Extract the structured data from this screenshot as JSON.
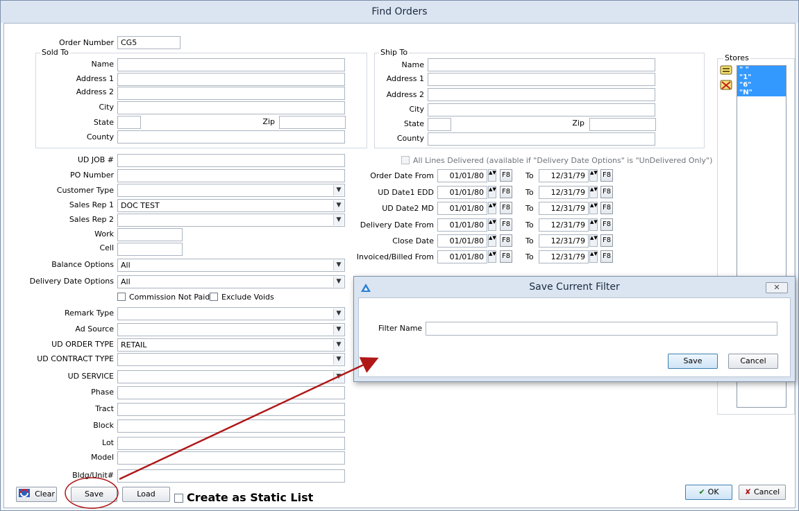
{
  "window": {
    "title": "Find Orders"
  },
  "order_number": {
    "label": "Order Number",
    "value": "CG5"
  },
  "sold_to": {
    "title": "Sold To",
    "name_label": "Name",
    "address1_label": "Address 1",
    "address2_label": "Address 2",
    "city_label": "City",
    "state_label": "State",
    "zip_label": "Zip",
    "county_label": "County"
  },
  "ship_to": {
    "title": "Ship To",
    "name_label": "Name",
    "address1_label": "Address 1",
    "address2_label": "Address 2",
    "city_label": "City",
    "state_label": "State",
    "zip_label": "Zip",
    "county_label": "County"
  },
  "fields": {
    "ud_job": "UD JOB #",
    "po_number": "PO Number",
    "customer_type": "Customer Type",
    "sales_rep1": "Sales Rep 1",
    "sales_rep1_value": "DOC TEST",
    "sales_rep2": "Sales Rep 2",
    "work": "Work",
    "cell": "Cell",
    "balance_options": "Balance Options",
    "balance_options_value": "All",
    "delivery_date_options": "Delivery Date Options",
    "delivery_date_options_value": "All",
    "commission_not_paid": "Commission Not Paid",
    "exclude_voids": "Exclude Voids",
    "remark_type": "Remark Type",
    "ad_source": "Ad Source",
    "ud_order_type": "UD ORDER TYPE",
    "ud_order_type_value": "RETAIL",
    "ud_contract_type": "UD CONTRACT TYPE",
    "ud_service": "UD SERVICE",
    "phase": "Phase",
    "tract": "Tract",
    "block": "Block",
    "lot": "Lot",
    "model": "Model",
    "bldg_unit": "Bldg/Unit#"
  },
  "all_lines_delivered": "All Lines Delivered (available if \"Delivery Date Options\" is \"UnDelivered Only\")",
  "date_ranges": [
    {
      "label": "Order Date From",
      "from": "01/01/80",
      "to_label": "To",
      "to": "12/31/79",
      "f8": "F8"
    },
    {
      "label": "UD Date1 EDD",
      "from": "01/01/80",
      "to_label": "To",
      "to": "12/31/79",
      "f8": "F8"
    },
    {
      "label": "UD Date2 MD",
      "from": "01/01/80",
      "to_label": "To",
      "to": "12/31/79",
      "f8": "F8"
    },
    {
      "label": "Delivery Date From",
      "from": "01/01/80",
      "to_label": "To",
      "to": "12/31/79",
      "f8": "F8"
    },
    {
      "label": "Close Date",
      "from": "01/01/80",
      "to_label": "To",
      "to": "12/31/79",
      "f8": "F8"
    },
    {
      "label": "Invoiced/Billed From",
      "from": "01/01/80",
      "to_label": "To",
      "to": "12/31/79",
      "f8": "F8"
    }
  ],
  "stores": {
    "title": "Stores",
    "items": [
      "\" \"",
      "\"1\"",
      "\"6\"",
      "\"N\""
    ]
  },
  "buttons": {
    "clear": "Clear",
    "save": "Save",
    "load": "Load",
    "create_static": "Create as Static List",
    "ok": "OK",
    "cancel": "Cancel"
  },
  "dialog": {
    "title": "Save Current Filter",
    "filter_name_label": "Filter Name",
    "filter_name_value": "",
    "save": "Save",
    "cancel": "Cancel"
  },
  "colors": {
    "accent": "#3399ff",
    "annotation": "#b01818",
    "titlebar": "#dbe5f1"
  }
}
